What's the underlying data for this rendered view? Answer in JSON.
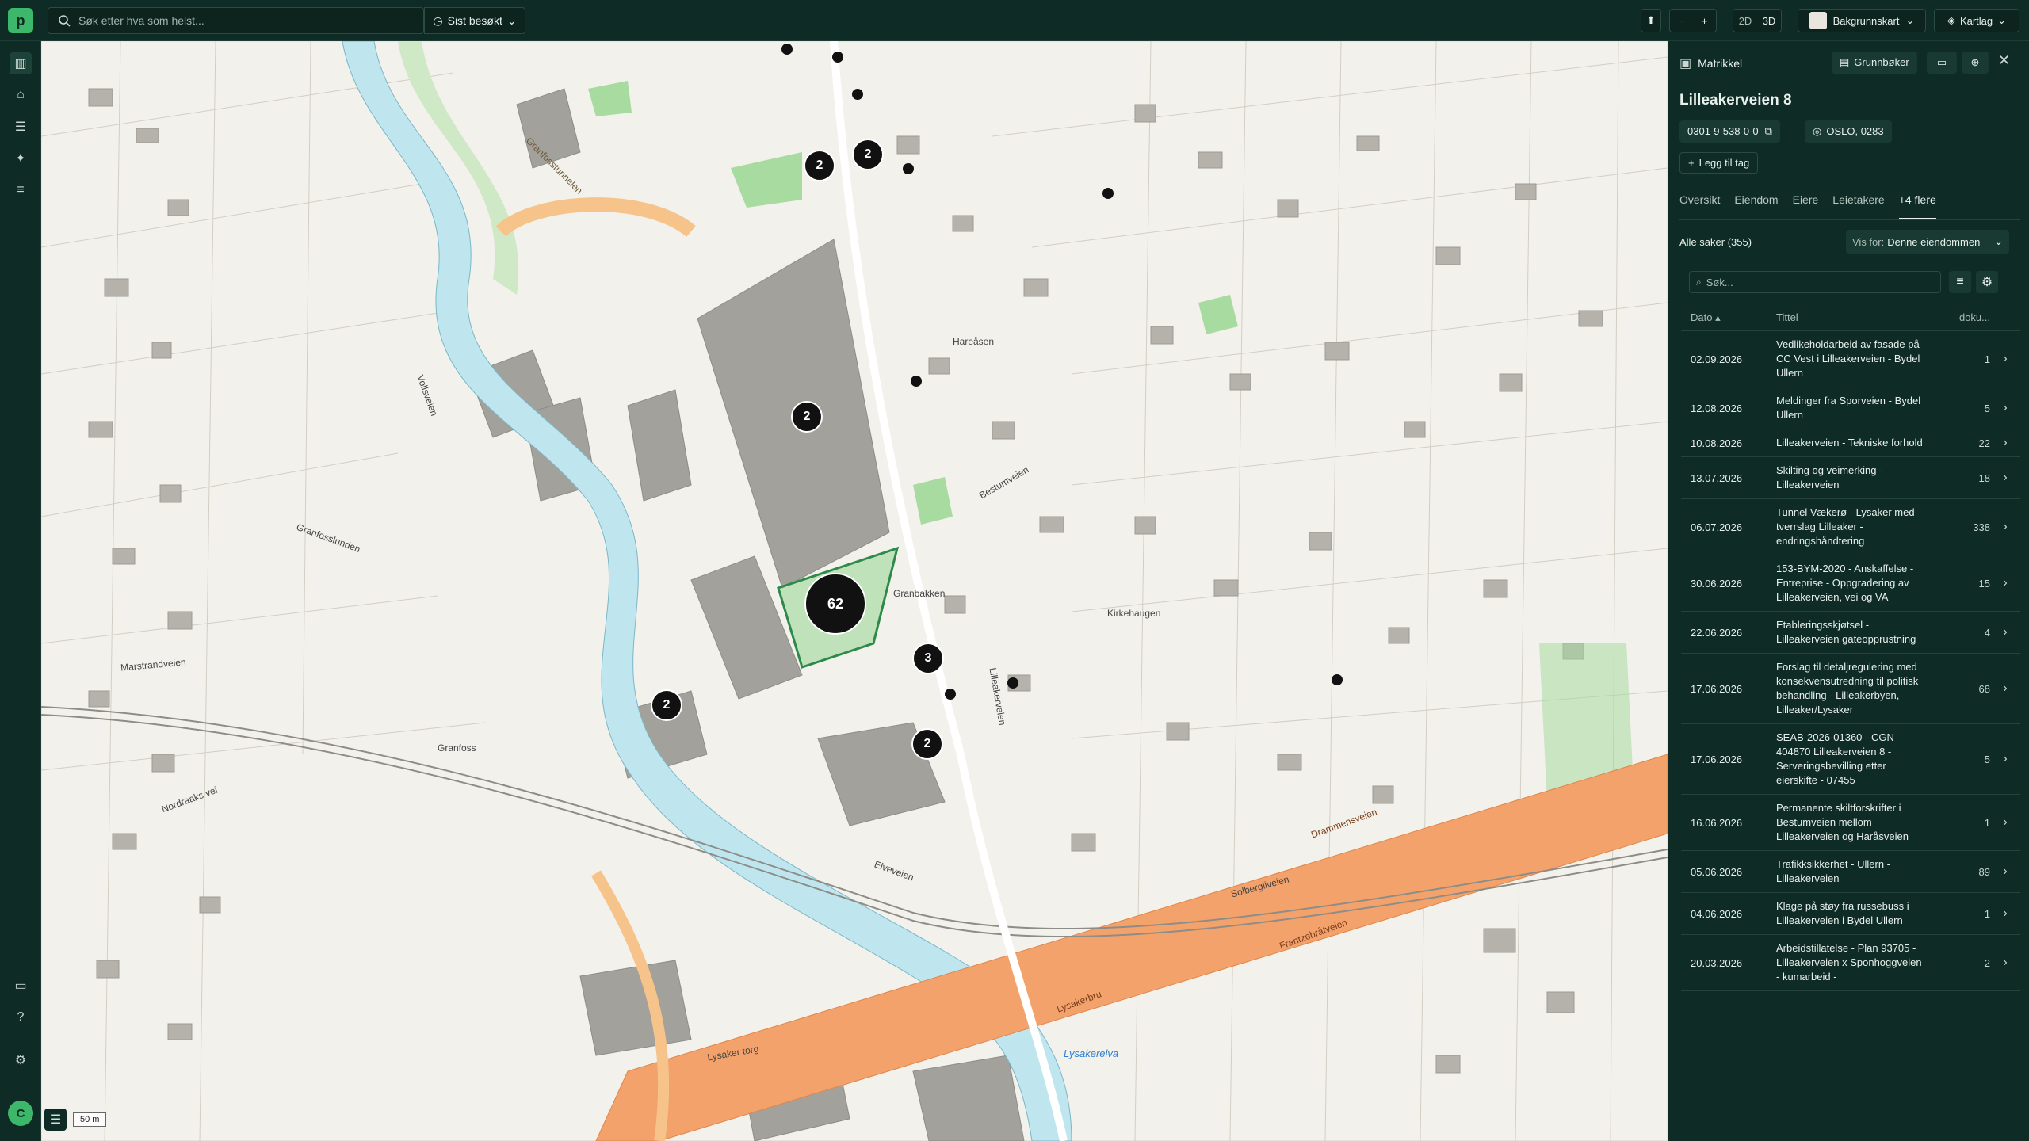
{
  "search": {
    "placeholder": "Søk etter hva som helst...",
    "recent_label": "Sist besøkt"
  },
  "toolbar": {
    "zoom_out": "−",
    "zoom_in": "+",
    "view_2d": "2D",
    "view_3d": "3D",
    "background_map": "Bakgrunnskart",
    "map_layers": "Kartlag"
  },
  "user": {
    "initial": "C"
  },
  "map": {
    "scale_label": "50 m",
    "clusters": [
      "2",
      "2",
      "2",
      "62",
      "3",
      "2",
      "2"
    ],
    "places": [
      "Granfosstunnelen",
      "Granfosslunden",
      "Lilleakerveien",
      "Vollsveien",
      "Hareåsen",
      "Granbakken",
      "Kirkehaugen",
      "Bestumveien",
      "Granfoss",
      "Marstrandveien",
      "Nordraaks vei",
      "Drammensveien",
      "Elveveien",
      "Lysaker torg",
      "Lysakerelva",
      "Frantzebråtveien",
      "Solbergliveien",
      "Lysakerbru"
    ]
  },
  "panel": {
    "section": "Matrikkel",
    "grunnboker": "Grunnbøker",
    "title": "Lilleakerveien 8",
    "matrikkel_id": "0301-9-538-0-0",
    "municipality": "OSLO, 0283",
    "add_tag": "Legg til tag",
    "tabs": [
      "Oversikt",
      "Eiendom",
      "Eiere",
      "Leietakere",
      "+4 flere"
    ],
    "cases_count": "Alle saker (355)",
    "view_for_label": "Vis for:",
    "view_for_value": "Denne eiendommen",
    "search_placeholder": "Søk...",
    "columns": [
      "Dato",
      "Tittel",
      "doku..."
    ],
    "rows": [
      {
        "date": "02.09.2026",
        "title": "Vedlikeholdarbeid av fasade på CC Vest i Lilleakerveien - Bydel Ullern",
        "count": "1"
      },
      {
        "date": "12.08.2026",
        "title": "Meldinger fra Sporveien - Bydel Ullern",
        "count": "5"
      },
      {
        "date": "10.08.2026",
        "title": "Lilleakerveien - Tekniske forhold",
        "count": "22"
      },
      {
        "date": "13.07.2026",
        "title": "Skilting og veimerking - Lilleakerveien",
        "count": "18"
      },
      {
        "date": "06.07.2026",
        "title": "Tunnel Vækerø - Lysaker med tverrslag Lilleaker - endringshåndtering",
        "count": "338"
      },
      {
        "date": "30.06.2026",
        "title": "153-BYM-2020 - Anskaffelse - Entreprise - Oppgradering av Lilleakerveien, vei og VA",
        "count": "15"
      },
      {
        "date": "22.06.2026",
        "title": "Etableringsskjøtsel - Lilleakerveien gateopprustning",
        "count": "4"
      },
      {
        "date": "17.06.2026",
        "title": "Forslag til detaljregulering med konsekvensutredning til politisk behandling - Lilleakerbyen, Lilleaker/Lysaker",
        "count": "68"
      },
      {
        "date": "17.06.2026",
        "title": "SEAB-2026-01360 - CGN 404870 Lilleakerveien 8 - Serveringsbevilling etter eierskifte - 07455",
        "count": "5"
      },
      {
        "date": "16.06.2026",
        "title": "Permanente skiltforskrifter i Bestumveien mellom Lilleakerveien og Haråsveien",
        "count": "1"
      },
      {
        "date": "05.06.2026",
        "title": "Trafikksikkerhet - Ullern - Lilleakerveien",
        "count": "89"
      },
      {
        "date": "04.06.2026",
        "title": "Klage på støy fra russebuss i Lilleakerveien i Bydel Ullern",
        "count": "1"
      },
      {
        "date": "20.03.2026",
        "title": "Arbeidstillatelse - Plan 93705 - Lilleakerveien x Sponhoggveien - kumarbeid -",
        "count": "2"
      }
    ]
  },
  "colors": {
    "brand": "#3db86a",
    "sidebar": "#0f2b25",
    "map_bg": "#f2f1ec",
    "road_orange": "#f3a26b",
    "water": "#bfe6ef",
    "green": "#9fd89a"
  }
}
